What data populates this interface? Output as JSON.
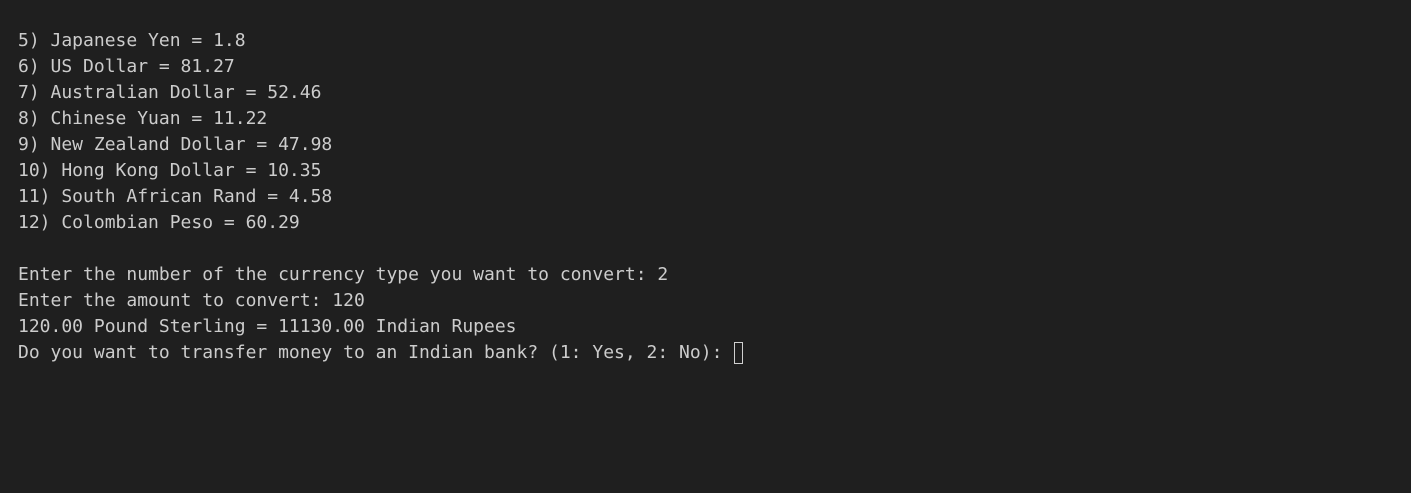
{
  "terminal": {
    "rates": [
      "5) Japanese Yen = 1.8",
      "6) US Dollar = 81.27",
      "7) Australian Dollar = 52.46",
      "8) Chinese Yuan = 11.22",
      "9) New Zealand Dollar = 47.98",
      "10) Hong Kong Dollar = 10.35",
      "11) South African Rand = 4.58",
      "12) Colombian Peso = 60.29"
    ],
    "prompt_currency": "Enter the number of the currency type you want to convert: 2",
    "prompt_amount": "Enter the amount to convert: 120",
    "result": "120.00 Pound Sterling = 11130.00 Indian Rupees",
    "prompt_transfer": "Do you want to transfer money to an Indian bank? (1: Yes, 2: No): "
  },
  "colors": {
    "background": "#1f1f1f",
    "text": "#cccccc"
  }
}
